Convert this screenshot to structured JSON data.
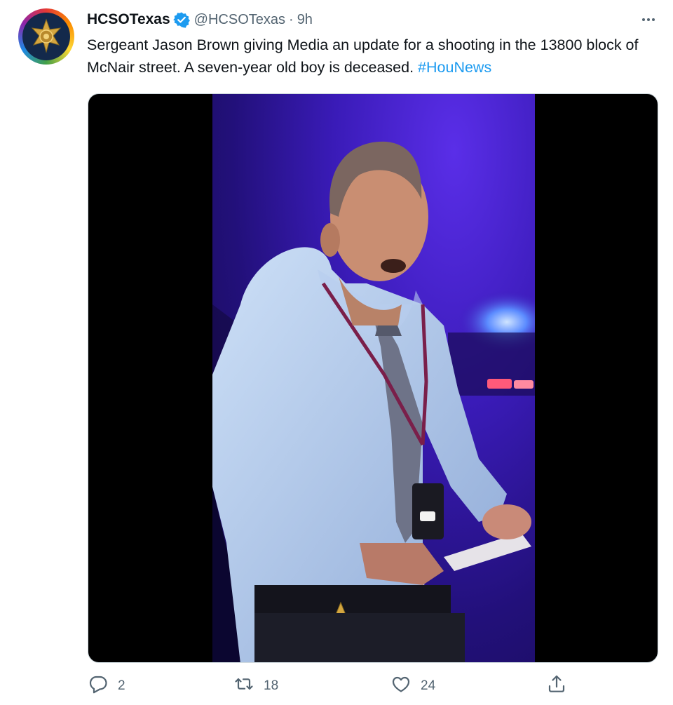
{
  "tweet": {
    "display_name": "HCSOTexas",
    "handle": "@HCSOTexas",
    "separator": "·",
    "time": "9h",
    "text": "Sergeant Jason Brown giving Media an update for a shooting in the 13800 block of McNair street. A seven-year old boy is deceased.",
    "hashtag": "#HouNews",
    "colors": {
      "accent": "#1d9bf0",
      "text": "#0f1419",
      "muted": "#536471"
    }
  },
  "actions": {
    "replies": "2",
    "retweets": "18",
    "likes": "24"
  }
}
